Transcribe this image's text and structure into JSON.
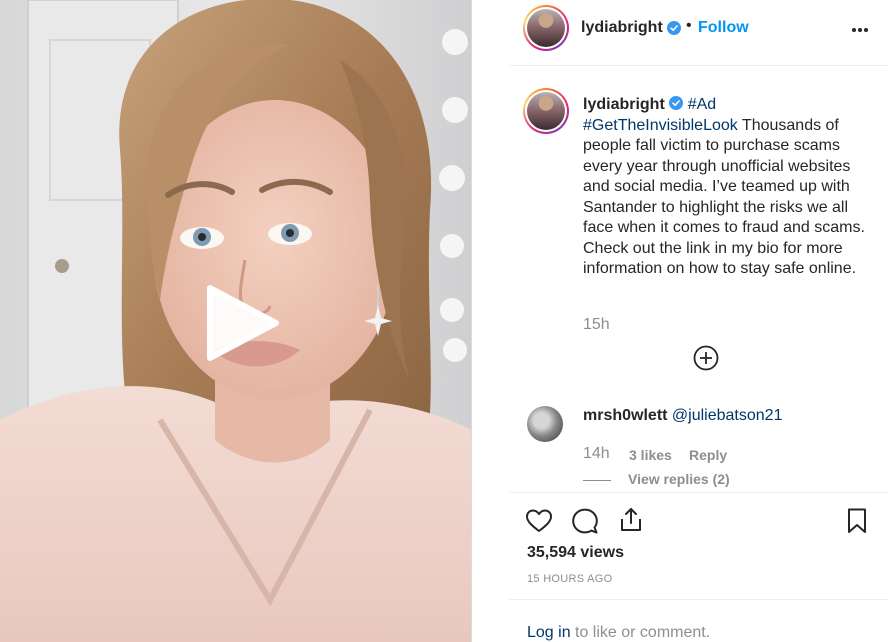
{
  "post": {
    "username": "lydiabright",
    "separator": "•",
    "follow_label": "Follow",
    "more_icon": "more-options-icon"
  },
  "caption": {
    "username": "lydiabright",
    "ad_tag": "#Ad",
    "hashtag": "#GetTheInvisibleLook",
    "text": " Thousands of people fall victim to purchase scams every year through unofficial websites and social media. I’ve teamed up with Santander to highlight the risks we all face when it comes to fraud and scams. Check out the link in my bio for more information on how to stay safe online.",
    "time": "15h"
  },
  "comment": {
    "username": "mrsh0wlett",
    "mention": "@juliebatson21",
    "time": "14h",
    "likes": "3 likes",
    "reply_label": "Reply",
    "view_replies": "View replies (2)"
  },
  "stats": {
    "views": "35,594 views",
    "posted_ago": "15 HOURS AGO"
  },
  "login": {
    "link": "Log in",
    "rest": " to like or comment."
  },
  "colors": {
    "accent": "#0095f6",
    "link": "#00376b",
    "muted": "#8e8e8e",
    "verified": "#3897f0"
  }
}
